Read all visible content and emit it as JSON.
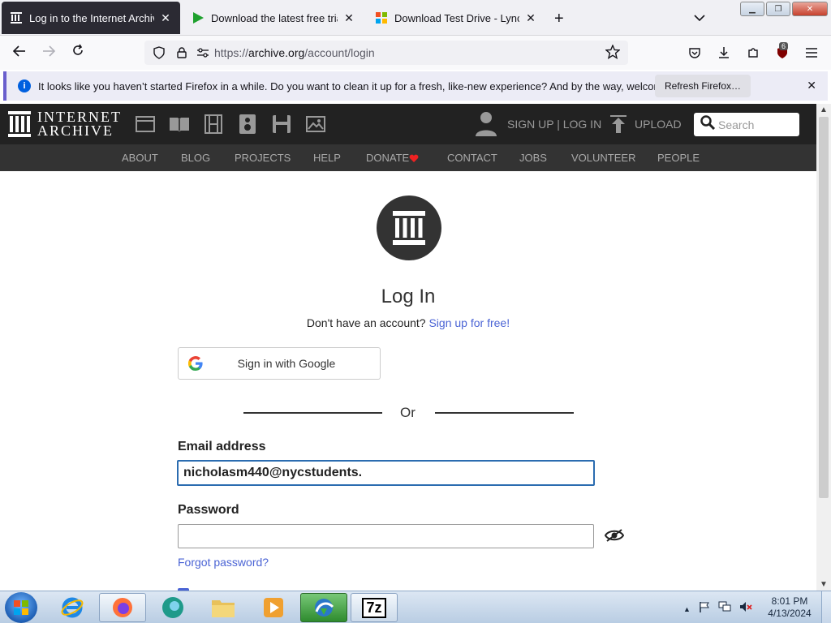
{
  "browser": {
    "tabs": [
      {
        "label": "Log in to the Internet Archive",
        "icon": "archive-favicon-icon",
        "active": true
      },
      {
        "label": "Download the latest free trial ve",
        "icon": "play-favicon-icon",
        "active": false
      },
      {
        "label": "Download Test Drive - Lync Ser",
        "icon": "microsoft-favicon-icon",
        "active": false
      }
    ],
    "url_scheme": "https://",
    "url_host": "archive.org",
    "url_path": "/account/login",
    "extension_badge": "6",
    "notification": {
      "text": "It looks like you haven’t started Firefox in a while. Do you want to clean it up for a fresh, like-new experience? And by the way, welcome back!",
      "button": "Refresh Firefox…"
    }
  },
  "site": {
    "logo_line1": "INTERNET",
    "logo_line2": "ARCHIVE",
    "signup_login": "SIGN UP | LOG IN",
    "upload": "UPLOAD",
    "search_placeholder": "Search",
    "nav": [
      "ABOUT",
      "BLOG",
      "PROJECTS",
      "HELP",
      "DONATE",
      "CONTACT",
      "JOBS",
      "VOLUNTEER",
      "PEOPLE"
    ],
    "accent_heart": "#e22"
  },
  "login": {
    "title": "Log In",
    "no_account": "Don't have an account?",
    "signup_link": "Sign up for free!",
    "google_button": "Sign in with Google",
    "or": "Or",
    "email_label": "Email address",
    "email_value": "nicholasm440@nycstudents.",
    "password_label": "Password",
    "password_value": "",
    "forgot": "Forgot password?"
  },
  "taskbar": {
    "time": "8:01 PM",
    "date": "4/13/2024",
    "seven_zip": "7z"
  }
}
